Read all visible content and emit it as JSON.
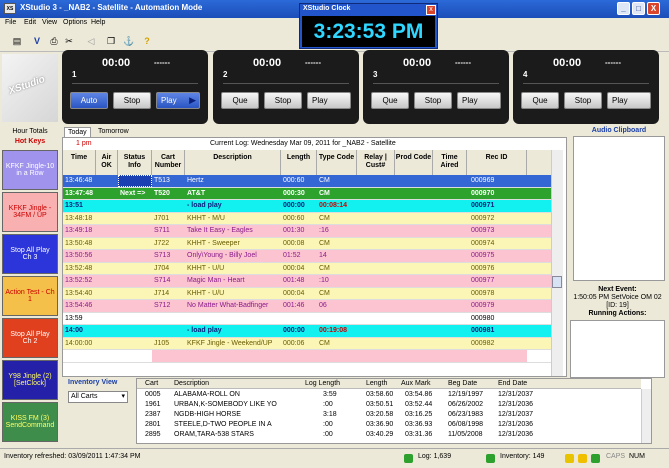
{
  "window": {
    "title": "XStudio 3 - _NAB2 - Satellite - Automation Mode",
    "logo_text": "XS",
    "controls": [
      "_",
      "□",
      "X"
    ]
  },
  "menu": [
    "File",
    "Edit",
    "View",
    "Options",
    "Help"
  ],
  "toolbar_icons": [
    "log-icon",
    "voice-track-icon",
    "print-icon",
    "cut-icon",
    "back-icon",
    "copy-icon",
    "network-icon",
    "help-icon"
  ],
  "logo_watermark": "XStudio",
  "clock": {
    "title": "XStudio Clock",
    "time": "3:23:53 PM",
    "close": "x"
  },
  "players": [
    {
      "number": "1",
      "time": "00:00",
      "dashes": "------",
      "buttons": [
        "Auto",
        "Stop",
        "Play"
      ]
    },
    {
      "number": "2",
      "time": "00:00",
      "dashes": "------",
      "buttons": [
        "Que",
        "Stop",
        "Play"
      ]
    },
    {
      "number": "3",
      "time": "00:00",
      "dashes": "------",
      "buttons": [
        "Que",
        "Stop",
        "Play"
      ]
    },
    {
      "number": "4",
      "time": "00:00",
      "dashes": "------",
      "buttons": [
        "Que",
        "Stop",
        "Play"
      ]
    }
  ],
  "side": {
    "hour_totals": "Hour Totals",
    "hot_keys": "Hot Keys",
    "keys": [
      {
        "label": "KFKF Jingle-10 in a Row",
        "color": "#9f93ee"
      },
      {
        "label": "KFKF Jingle - 34FM / UP",
        "color": "#f8b0b0"
      },
      {
        "label": "Stop All Play Ch 3",
        "color": "#2b35d9"
      },
      {
        "label": "Action Test - Ch 1",
        "color": "#f5c04a"
      },
      {
        "label": "Stop All Play Ch 2",
        "color": "#e1401f"
      },
      {
        "label": "Y98 Jingle (2) [SetClock]",
        "color": "#2420a8"
      },
      {
        "label": "KISS FM (3) SendCommand",
        "color": "#3f8d4a"
      }
    ]
  },
  "tabs": [
    "Today",
    "Tomorrow"
  ],
  "log": {
    "hour_label": "1 pm",
    "caption": "Current Log: Wednesday Mar 09, 2011 for _NAB2 - Satellite",
    "columns": [
      "Time",
      "Air OK",
      "Status Info",
      "Cart Number",
      "Description",
      "Length",
      "Type Code",
      "Relay | Cust#",
      "Prod Code",
      "Time Aired",
      "Rec ID"
    ],
    "rows": [
      {
        "time": "13:46:48",
        "air": "",
        "status": "",
        "cart": "T513",
        "desc": "Hertz",
        "length": "000:60",
        "type": "CM",
        "relay": "",
        "prod": "",
        "aired": "",
        "rec": "000969",
        "style": "selected"
      },
      {
        "time": "13:47:48",
        "air": "",
        "status": "Next =>",
        "cart": "T520",
        "desc": "AT&T",
        "length": "000:30",
        "type": "CM",
        "relay": "",
        "prod": "",
        "aired": "",
        "rec": "000970",
        "style": "next"
      },
      {
        "time": "13:51",
        "air": "",
        "status": "",
        "cart": "",
        "desc": "- load play",
        "length": "000:00",
        "type": "00:08:14",
        "relay": "",
        "prod": "",
        "aired": "",
        "rec": "000971",
        "style": "cyan"
      },
      {
        "time": "13:48:18",
        "air": "",
        "status": "",
        "cart": "J701",
        "desc": "KHHT - M/U",
        "length": "000:60",
        "type": "CM",
        "relay": "",
        "prod": "",
        "aired": "",
        "rec": "000972",
        "style": "yellow"
      },
      {
        "time": "13:49:18",
        "air": "",
        "status": "",
        "cart": "S711",
        "desc": "Take It Easy - Eagles",
        "length": "001:30",
        "type": ":16",
        "relay": "",
        "prod": "",
        "aired": "",
        "rec": "000973",
        "style": "pink"
      },
      {
        "time": "13:50:48",
        "air": "",
        "status": "",
        "cart": "J722",
        "desc": "KHHT - Sweeper",
        "length": "000:08",
        "type": "CM",
        "relay": "",
        "prod": "",
        "aired": "",
        "rec": "000974",
        "style": "yellow"
      },
      {
        "time": "13:50:56",
        "air": "",
        "status": "",
        "cart": "S713",
        "desc": "Only\\Young - Billy Joel",
        "length": "01:52",
        "type": "14",
        "relay": "",
        "prod": "",
        "aired": "",
        "rec": "000975",
        "style": "pink"
      },
      {
        "time": "13:52:48",
        "air": "",
        "status": "",
        "cart": "J704",
        "desc": "KHHT - U/U",
        "length": "000:04",
        "type": "CM",
        "relay": "",
        "prod": "",
        "aired": "",
        "rec": "000976",
        "style": "yellow"
      },
      {
        "time": "13:52:52",
        "air": "",
        "status": "",
        "cart": "S714",
        "desc": "Magic Man - Heart",
        "length": "001:48",
        "type": ":10",
        "relay": "",
        "prod": "",
        "aired": "",
        "rec": "000977",
        "style": "pink"
      },
      {
        "time": "13:54:40",
        "air": "",
        "status": "",
        "cart": "J714",
        "desc": "KHHT - U/U",
        "length": "000:04",
        "type": "CM",
        "relay": "",
        "prod": "",
        "aired": "",
        "rec": "000978",
        "style": "yellow"
      },
      {
        "time": "13:54:46",
        "air": "",
        "status": "",
        "cart": "S712",
        "desc": "No Matter What-Badfinger",
        "length": "001:46",
        "type": "06",
        "relay": "",
        "prod": "",
        "aired": "",
        "rec": "000979",
        "style": "pink"
      },
      {
        "time": "13:59",
        "air": "",
        "status": "",
        "cart": "",
        "desc": "",
        "length": "",
        "type": "",
        "relay": "",
        "prod": "",
        "aired": "",
        "rec": "000980",
        "style": "white"
      },
      {
        "time": "14:00",
        "air": "",
        "status": "",
        "cart": "",
        "desc": "- load play",
        "length": "000:00",
        "type": "00:19:08",
        "relay": "",
        "prod": "",
        "aired": "",
        "rec": "000981",
        "style": "cyan"
      },
      {
        "time": "14:00:00",
        "air": "",
        "status": "",
        "cart": "J105",
        "desc": "KFKF Jingle - Weekend/UP",
        "length": "000:06",
        "type": "CM",
        "relay": "",
        "prod": "",
        "aired": "",
        "rec": "000982",
        "style": "yellow"
      },
      {
        "time": "",
        "air": "",
        "status": "",
        "cart": "",
        "desc": "",
        "length": "",
        "type": "",
        "relay": "",
        "prod": "",
        "aired": "",
        "rec": "",
        "style": "pinkpart"
      }
    ]
  },
  "clipboard": {
    "title": "Audio Clipboard"
  },
  "next_event": {
    "title": "Next Event:",
    "detail": "1:50:05 PM SetVoice OM 02",
    "id": "[ID: 19]"
  },
  "running_actions": "Running Actions:",
  "inventory": {
    "title": "Inventory View",
    "filter": "All Carts",
    "columns": [
      "Cart",
      "Description",
      "Log Length",
      "Length",
      "Aux Mark",
      "Beg Date",
      "End Date"
    ],
    "rows": [
      {
        "cart": "0005",
        "desc": "ALABAMA-ROLL ON",
        "log": "3:59",
        "len": "03:58.60",
        "aux": "03:54.86",
        "beg": "12/19/1997",
        "end": "12/31/2037"
      },
      {
        "cart": "1961",
        "desc": "URBAN,K-SOMEBODY LIKE YO",
        "log": ":00",
        "len": "03:50.51",
        "aux": "03:52.44",
        "beg": "06/26/2002",
        "end": "12/31/2036"
      },
      {
        "cart": "2387",
        "desc": "NGDB-HIGH HORSE",
        "log": "3:18",
        "len": "03:20.58",
        "aux": "03:16.25",
        "beg": "06/23/1983",
        "end": "12/31/2037"
      },
      {
        "cart": "2801",
        "desc": "STEELE,D-TWO PEOPLE IN A",
        "log": ":00",
        "len": "03:36.90",
        "aux": "03:36.93",
        "beg": "06/08/1998",
        "end": "12/31/2036"
      },
      {
        "cart": "2895",
        "desc": "ORAM,TARA-538 STARS",
        "log": ":00",
        "len": "03:40.29",
        "aux": "03:31.36",
        "beg": "11/05/2008",
        "end": "12/31/2036"
      }
    ]
  },
  "status": {
    "refreshed": "Inventory refreshed: 03/09/2011 1:47:34 PM",
    "log": "Log: 1,639",
    "inventory": "Inventory: 149",
    "caps": "CAPS",
    "num": "NUM"
  },
  "colors": {
    "selected": "#3466d4",
    "next": "#2da32d",
    "cyan": "#13f0f0",
    "yellow": "#fbf6b6",
    "pink": "#fbc4d0"
  }
}
